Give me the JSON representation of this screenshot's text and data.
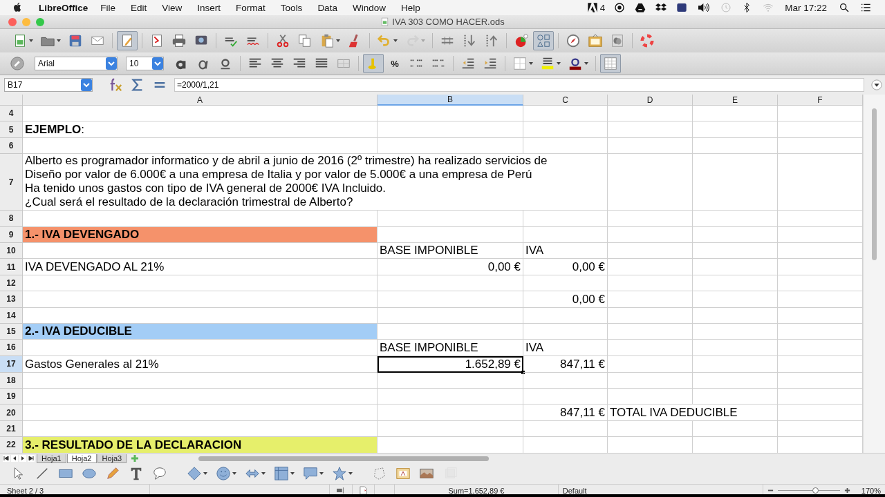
{
  "menubar": {
    "app": "LibreOffice",
    "items": [
      "File",
      "Edit",
      "View",
      "Insert",
      "Format",
      "Tools",
      "Data",
      "Window",
      "Help"
    ],
    "adobe_count": "4",
    "clock": "Mar 17:22"
  },
  "window": {
    "title": "IVA 303 COMO HACER.ods"
  },
  "standard_toolbar": [
    {
      "kind": "new",
      "pressed": false,
      "disabled": false
    },
    {
      "kind": "open",
      "pressed": false,
      "disabled": false
    },
    {
      "kind": "save",
      "pressed": false,
      "disabled": false
    },
    {
      "kind": "email",
      "pressed": false,
      "disabled": false
    },
    {
      "kind": "edit",
      "pressed": true,
      "disabled": false
    },
    {
      "kind": "pdf",
      "pressed": false,
      "disabled": false
    },
    {
      "kind": "print",
      "pressed": false,
      "disabled": false
    },
    {
      "kind": "preview",
      "pressed": false,
      "disabled": false
    },
    {
      "kind": "spell",
      "pressed": false,
      "disabled": false
    },
    {
      "kind": "autospell",
      "pressed": false,
      "disabled": false
    },
    {
      "kind": "cut",
      "pressed": false,
      "disabled": false
    },
    {
      "kind": "copy",
      "pressed": false,
      "disabled": false
    },
    {
      "kind": "paste",
      "pressed": false,
      "disabled": false
    },
    {
      "kind": "clone",
      "pressed": false,
      "disabled": false
    },
    {
      "kind": "undo",
      "pressed": false,
      "disabled": false
    },
    {
      "kind": "redo",
      "pressed": false,
      "disabled": true
    },
    {
      "kind": "link",
      "pressed": false,
      "disabled": false
    },
    {
      "kind": "sortdesc",
      "pressed": false,
      "disabled": false
    },
    {
      "kind": "sortasc",
      "pressed": false,
      "disabled": false
    },
    {
      "kind": "chart",
      "pressed": false,
      "disabled": false
    },
    {
      "kind": "draw",
      "pressed": true,
      "disabled": false
    },
    {
      "kind": "navigator",
      "pressed": false,
      "disabled": false
    },
    {
      "kind": "gallery",
      "pressed": false,
      "disabled": false
    },
    {
      "kind": "datasource",
      "pressed": false,
      "disabled": false
    },
    {
      "kind": "help",
      "pressed": false,
      "disabled": false
    }
  ],
  "format_toolbar": {
    "sidebar_pressed": false,
    "font_name": "Arial",
    "font_size": "10",
    "items": [
      {
        "kind": "bold",
        "pressed": false
      },
      {
        "kind": "italic",
        "pressed": false
      },
      {
        "kind": "underline",
        "pressed": false
      },
      {
        "kind": "align-left",
        "pressed": false
      },
      {
        "kind": "align-center",
        "pressed": false
      },
      {
        "kind": "align-right",
        "pressed": false
      },
      {
        "kind": "justify",
        "pressed": false
      },
      {
        "kind": "merge",
        "pressed": false
      },
      {
        "kind": "currency",
        "pressed": true
      },
      {
        "kind": "percent",
        "pressed": false,
        "label": "%"
      },
      {
        "kind": "add-decimal",
        "pressed": false
      },
      {
        "kind": "delete-decimal",
        "pressed": false
      },
      {
        "kind": "decrease-indent",
        "pressed": false
      },
      {
        "kind": "increase-indent",
        "pressed": false
      },
      {
        "kind": "borders",
        "pressed": false
      },
      {
        "kind": "background-color",
        "pressed": false
      },
      {
        "kind": "font-color",
        "pressed": false
      },
      {
        "kind": "grid",
        "pressed": true
      }
    ]
  },
  "formula_bar": {
    "name_box": "B17",
    "formula": "=2000/1,21"
  },
  "columns": [
    {
      "label": "A",
      "selected": false
    },
    {
      "label": "B",
      "selected": true
    },
    {
      "label": "C",
      "selected": false
    },
    {
      "label": "D",
      "selected": false
    },
    {
      "label": "E",
      "selected": false
    },
    {
      "label": "F",
      "selected": false
    }
  ],
  "rows": [
    {
      "label": "4",
      "selected": false
    },
    {
      "label": "5",
      "selected": false,
      "cells": [
        {
          "text": "**EJEMPLO**:",
          "kind": "text"
        }
      ]
    },
    {
      "label": "6",
      "selected": false
    },
    {
      "label": "7",
      "selected": false,
      "cells": [
        {
          "text": "Alberto es programador informatico y de abril a junio de 2016 (2º trimestre) ha realizado servicios de\nDiseño por valor de 6.000€ a una empresa de Italia y por valor de 5.000€ a una empresa de Perú\nHa tenido unos gastos con tipo de IVA general de 2000€ IVA Incluido.\n¿Cual será el resultado de la declaración trimestral de Alberto?",
          "kind": "text"
        }
      ]
    },
    {
      "label": "8",
      "selected": false
    },
    {
      "label": "9",
      "selected": false,
      "cells": [
        {
          "text": "1.- IVA DEVENGADO",
          "kind": "heading",
          "color": "#f5926b"
        }
      ]
    },
    {
      "label": "10",
      "selected": false,
      "cells": [
        {},
        {
          "text": "BASE IMPONIBLE",
          "kind": "text"
        },
        {
          "text": "IVA",
          "kind": "text"
        }
      ]
    },
    {
      "label": "11",
      "selected": false,
      "cells": [
        {
          "text": "IVA DEVENGADO AL 21%",
          "kind": "text"
        },
        {
          "text": "0,00 €",
          "kind": "number"
        },
        {
          "text": "0,00 €",
          "kind": "number"
        }
      ]
    },
    {
      "label": "12",
      "selected": false
    },
    {
      "label": "13",
      "selected": false,
      "cells": [
        {},
        {},
        {
          "text": "0,00 €",
          "kind": "number"
        }
      ]
    },
    {
      "label": "14",
      "selected": false
    },
    {
      "label": "15",
      "selected": false,
      "cells": [
        {
          "text": "2.- IVA DEDUCIBLE",
          "kind": "heading",
          "color": "#a3cdf6"
        }
      ]
    },
    {
      "label": "16",
      "selected": false,
      "cells": [
        {},
        {
          "text": "BASE IMPONIBLE",
          "kind": "text"
        },
        {
          "text": "IVA",
          "kind": "text"
        }
      ]
    },
    {
      "label": "17",
      "selected": true,
      "cells": [
        {
          "text": "Gastos Generales al 21%",
          "kind": "text"
        },
        {
          "text": "1.652,89 €",
          "kind": "number",
          "selected": true
        },
        {
          "text": "847,11 €",
          "kind": "number"
        }
      ]
    },
    {
      "label": "18",
      "selected": false
    },
    {
      "label": "19",
      "selected": false
    },
    {
      "label": "20",
      "selected": false,
      "cells": [
        {},
        {},
        {
          "text": "847,11 €",
          "kind": "number"
        },
        {
          "text": "TOTAL IVA DEDUCIBLE",
          "kind": "text"
        }
      ]
    },
    {
      "label": "21",
      "selected": false
    },
    {
      "label": "22",
      "selected": false,
      "cells": [
        {
          "text": "3.- RESULTADO DE LA DECLARACION",
          "kind": "heading",
          "color": "#e6ef6b"
        }
      ]
    }
  ],
  "sheet_tabs": [
    {
      "label": "Hoja1",
      "selected": false
    },
    {
      "label": "Hoja2",
      "selected": true
    },
    {
      "label": "Hoja3",
      "selected": false
    }
  ],
  "drawing_toolbar": [
    {
      "kind": "select",
      "disabled": false
    },
    {
      "kind": "line",
      "disabled": false
    },
    {
      "kind": "rectangle",
      "disabled": false
    },
    {
      "kind": "ellipse",
      "disabled": false
    },
    {
      "kind": "freeform",
      "disabled": false
    },
    {
      "kind": "text",
      "disabled": false
    },
    {
      "kind": "callout",
      "disabled": false
    },
    {
      "kind": "basic-shapes",
      "disabled": false
    },
    {
      "kind": "symbol-shapes",
      "disabled": false
    },
    {
      "kind": "block-arrows",
      "disabled": false
    },
    {
      "kind": "flowchart",
      "disabled": false
    },
    {
      "kind": "callouts",
      "disabled": false
    },
    {
      "kind": "stars",
      "disabled": false
    },
    {
      "kind": "points",
      "disabled": false
    },
    {
      "kind": "fontwork",
      "disabled": false
    },
    {
      "kind": "from-file",
      "disabled": false
    },
    {
      "kind": "extrusion",
      "disabled": true
    }
  ],
  "status_bar": {
    "sheet": "Sheet 2 / 3",
    "page_style": "Default",
    "sum": "Sum=1.652,89 €",
    "zoom": "170%",
    "zoom_level": {
      "level": 0.6
    }
  }
}
